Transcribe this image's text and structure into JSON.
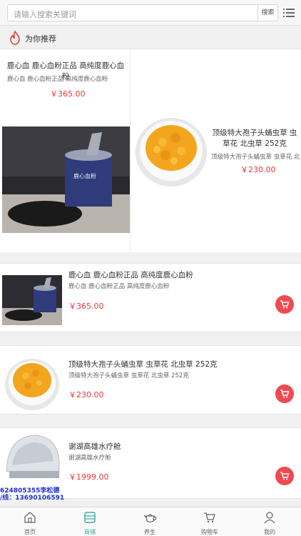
{
  "search": {
    "placeholder": "请输入搜索关键词",
    "button_label": "搜索"
  },
  "section": {
    "title": "为你推荐"
  },
  "grid": [
    {
      "title": "鹿心血 鹿心血粉正品 高纯度鹿心血粉",
      "subtitle": "鹿心血 鹿心血粉正品 高纯度鹿心血粉",
      "price": "￥365.00"
    },
    {
      "title": "顶级特大孢子头蛹虫草 虫草花 北虫草 252克",
      "subtitle": "顶级特大孢子头蛹虫草 虫草花 北...",
      "price": "￥230.00"
    }
  ],
  "list": [
    {
      "title": "鹿心血 鹿心血粉正品 高纯度鹿心血粉",
      "subtitle": "鹿心血 鹿心血粉正品 高纯度鹿心血粉",
      "price": "￥365.00"
    },
    {
      "title": "顶级特大孢子头蛹虫草 虫草花 北虫草 252克",
      "subtitle": "顶级特大孢子头蛹虫草 虫草花 北虫草 252克",
      "price": "￥230.00"
    },
    {
      "title": "谢湖高雄水疗舱",
      "subtitle": "谢湖高雄水疗舱",
      "price": "￥1999.00"
    }
  ],
  "contact": {
    "line1": "624805355李松德",
    "line2": "/线：13690106591"
  },
  "tabs": [
    {
      "label": "首页",
      "icon": "home-icon"
    },
    {
      "label": "商铺",
      "icon": "store-icon",
      "active": true
    },
    {
      "label": "养生",
      "icon": "teapot-icon"
    },
    {
      "label": "购物车",
      "icon": "cart-icon"
    },
    {
      "label": "我的",
      "icon": "user-icon"
    }
  ],
  "colors": {
    "price": "#e4393c",
    "cart_button": "#ee4a50",
    "active_tab": "#3aa99f"
  }
}
